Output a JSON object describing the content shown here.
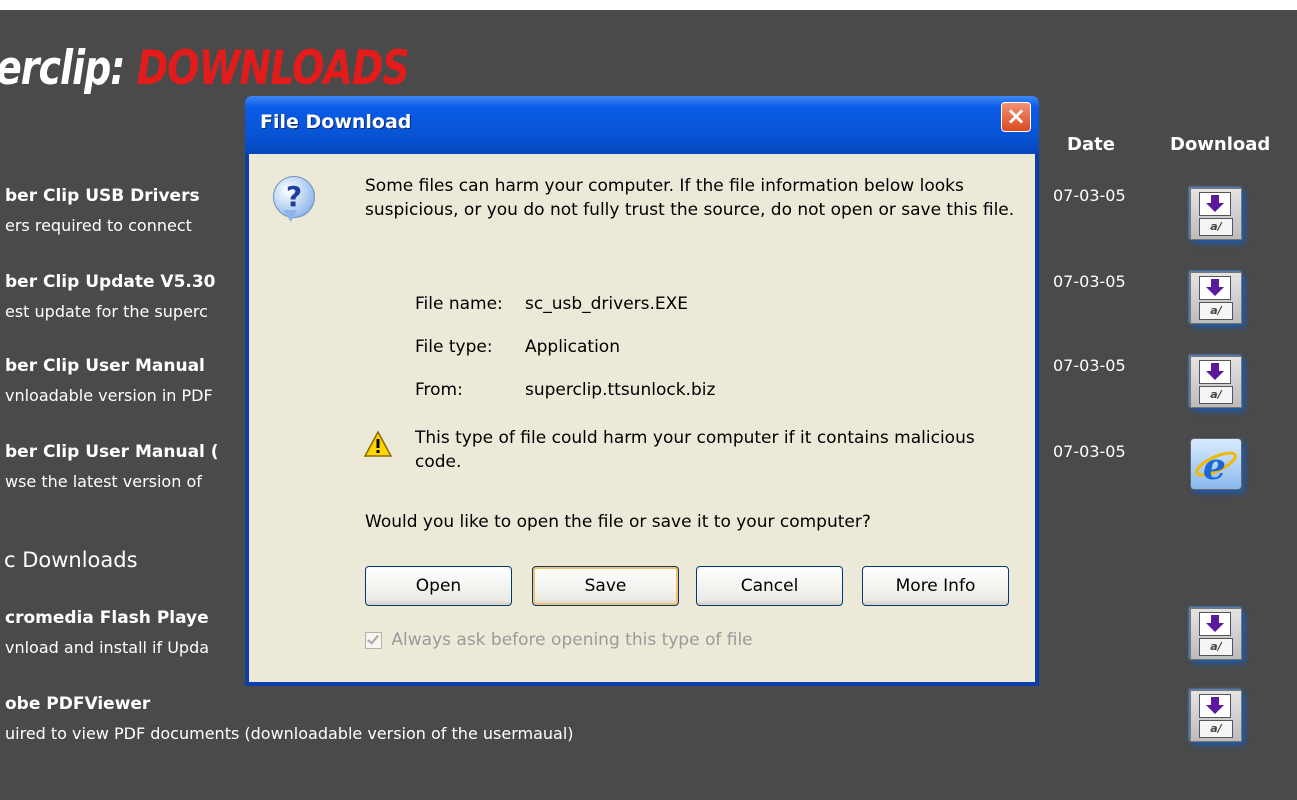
{
  "site": {
    "title_part1": "erclip:",
    "title_part2": "DOWNLOADS"
  },
  "columns": {
    "date": "Date",
    "download": "Download"
  },
  "downloads": [
    {
      "title": "ber Clip USB Drivers",
      "desc": "ers required to connect",
      "date": "07-03-05",
      "icon": "download-icon"
    },
    {
      "title": "ber Clip Update V5.30",
      "desc": "est update for the superc",
      "date": "07-03-05",
      "icon": "download-icon"
    },
    {
      "title": "ber Clip User Manual",
      "desc": "vnloadable version in PDF",
      "date": "07-03-05",
      "icon": "download-icon"
    },
    {
      "title": "ber Clip User Manual (",
      "desc": "wse the latest version of",
      "date": "07-03-05",
      "icon": "internet-explorer-icon"
    }
  ],
  "misc": {
    "section_title": "c Downloads",
    "items": [
      {
        "title": "cromedia Flash Playe",
        "desc": "vnload and install if Upda",
        "icon": "download-icon"
      },
      {
        "title": "obe PDFViewer",
        "desc": "uired to view PDF documents (downloadable version of the usermaual)",
        "icon": "download-icon"
      }
    ]
  },
  "dialog": {
    "title": "File Download",
    "close": "×",
    "warning": "Some files can harm your computer. If the file information below looks suspicious, or you do not fully trust the source, do not open or save this file.",
    "file_name_label": "File name:",
    "file_name": "sc_usb_drivers.EXE",
    "file_type_label": "File type:",
    "file_type": "Application",
    "from_label": "From:",
    "from": "superclip.ttsunlock.biz",
    "harm_notice": "This type of file could harm your computer if it contains malicious code.",
    "question": "Would you like to open the file or save it to your computer?",
    "buttons": {
      "open": "Open",
      "save": "Save",
      "cancel": "Cancel",
      "more_info": "More Info"
    },
    "always_ask": "Always ask before opening this type of file",
    "always_ask_checked": true
  },
  "colors": {
    "page_bg": "#4a4a4a",
    "title_red": "#e41b1b",
    "dialog_titlebar": "#0756d8",
    "dialog_body": "#ece9d8"
  }
}
